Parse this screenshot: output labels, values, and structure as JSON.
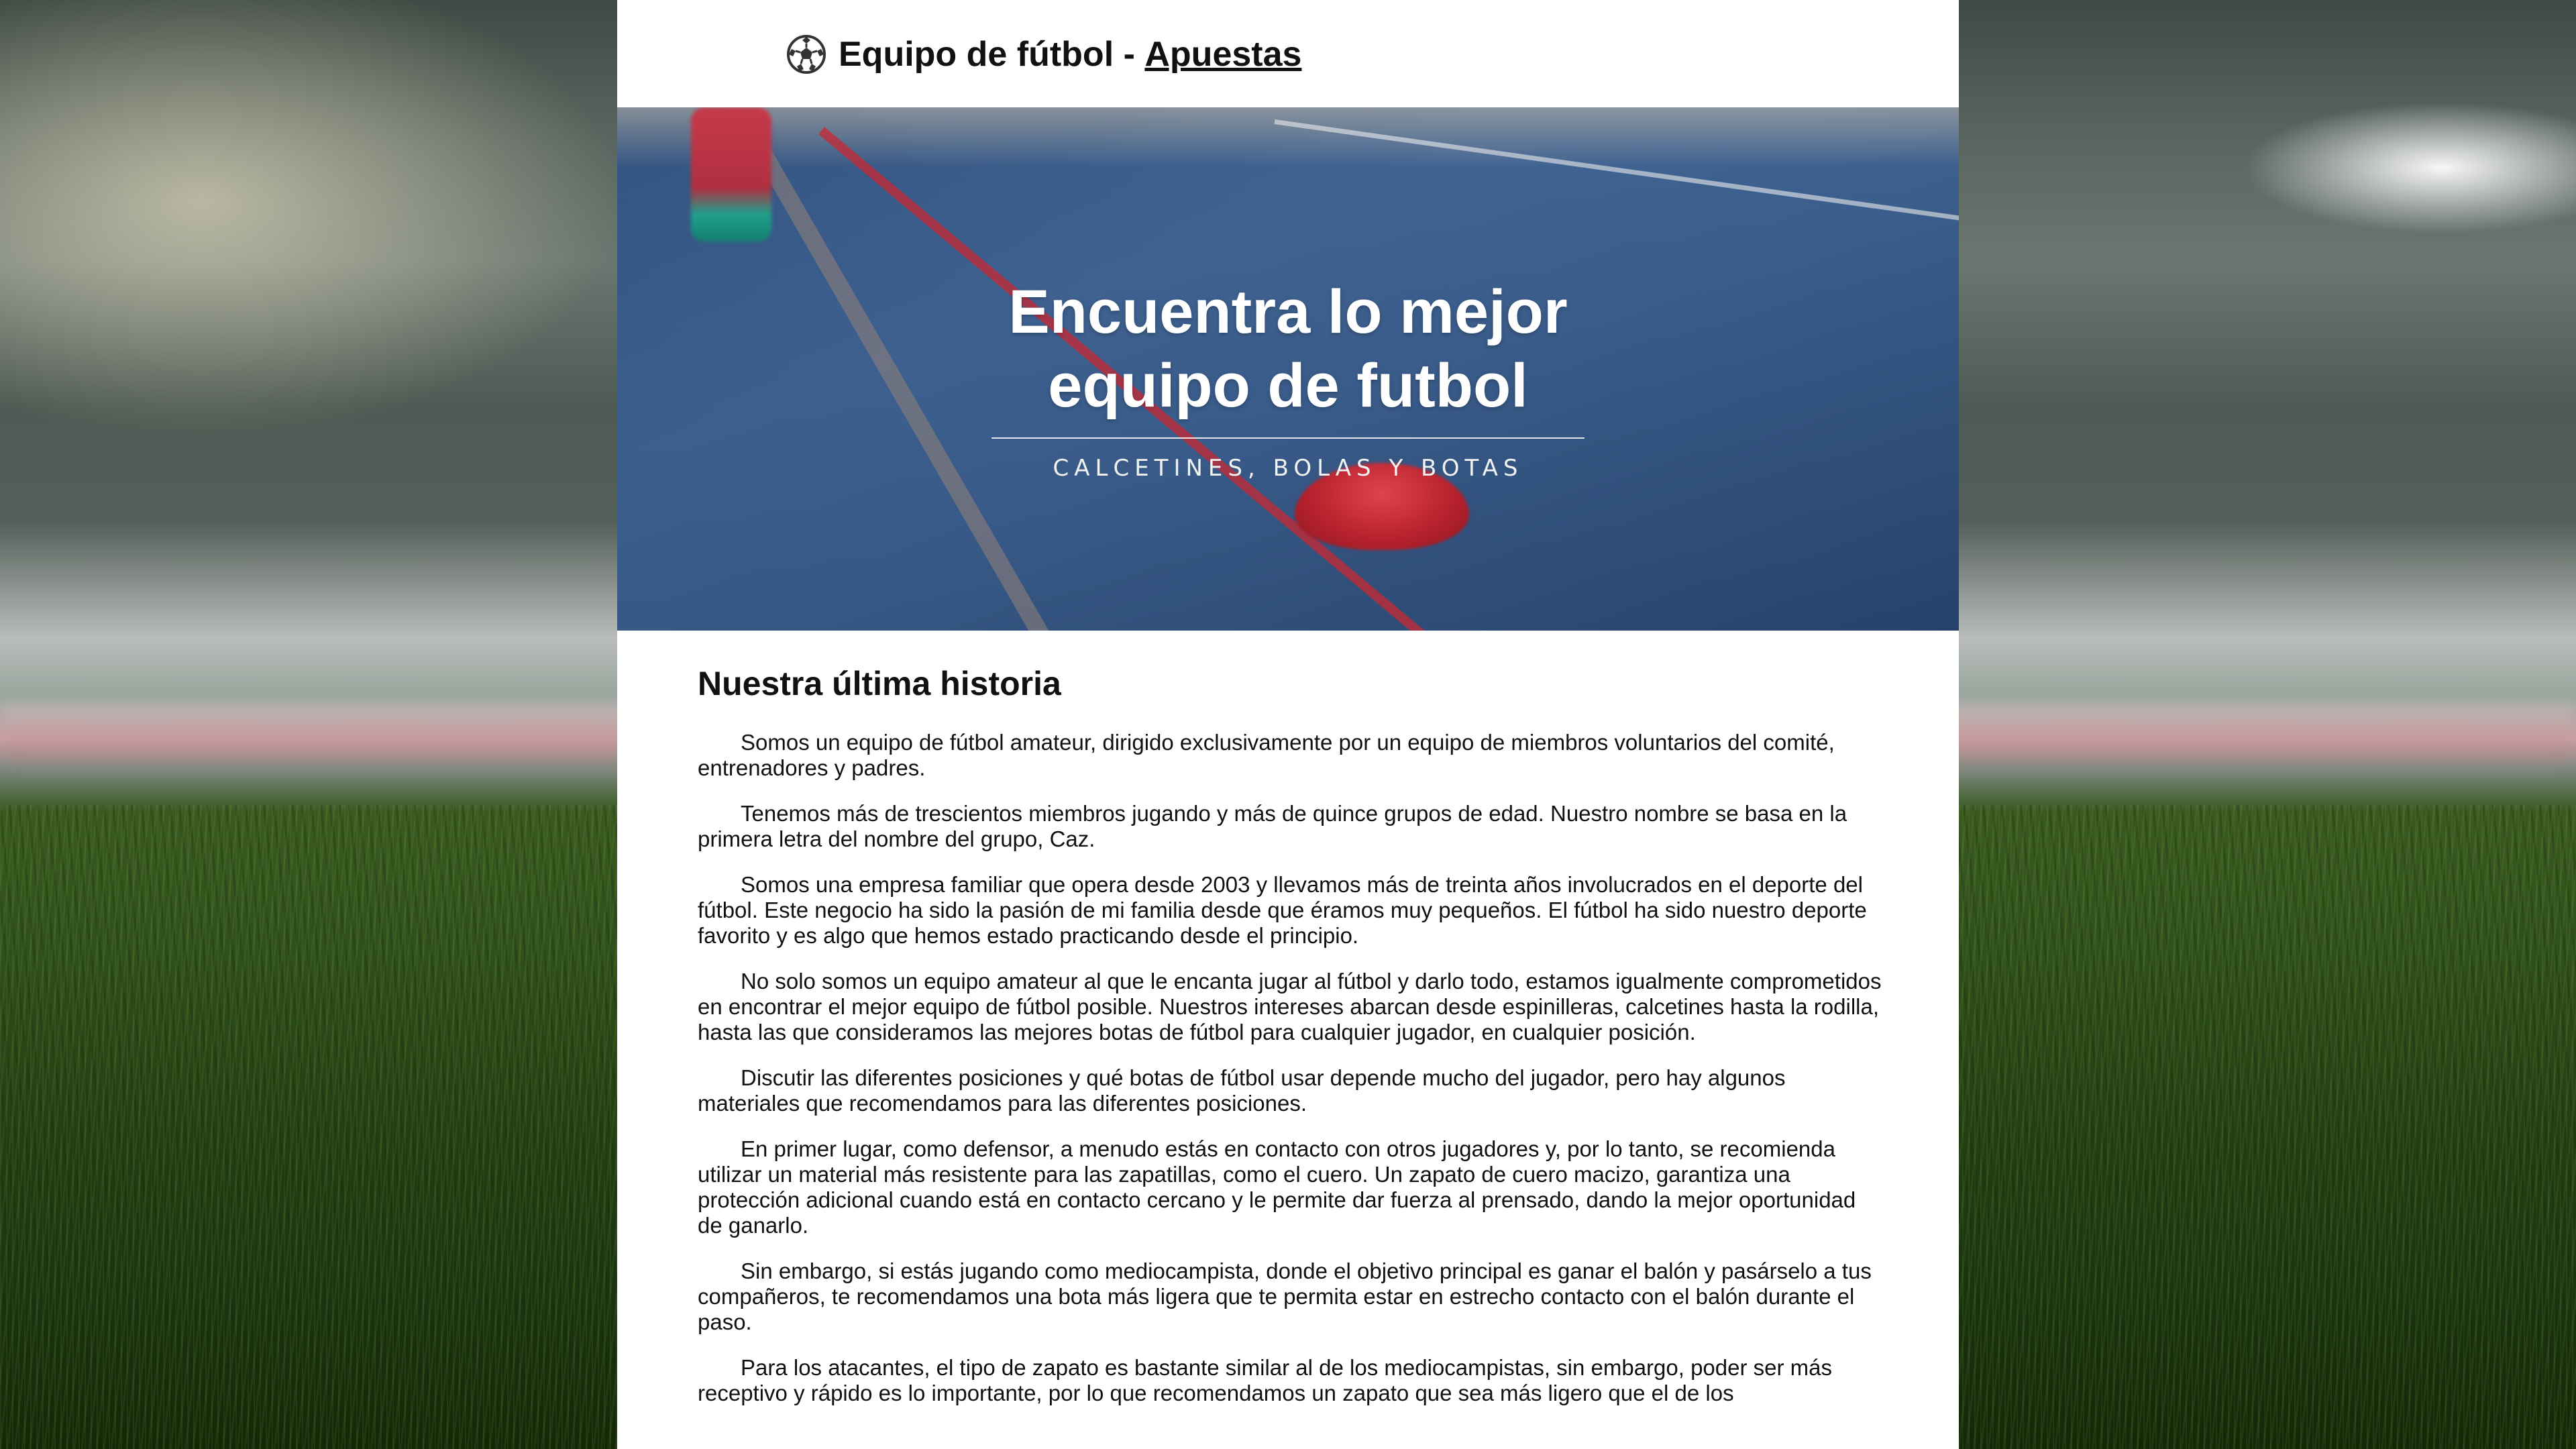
{
  "header": {
    "title_prefix": "Equipo de fútbol - ",
    "title_link": "Apuestas",
    "logo_icon": "soccer-ball-icon"
  },
  "hero": {
    "title_line1": "Encuentra lo mejor",
    "title_line2": "equipo de futbol",
    "subtitle": "CALCETINES, BOLAS Y BOTAS"
  },
  "story": {
    "heading": "Nuestra última historia",
    "paragraphs": [
      "Somos un equipo de fútbol amateur, dirigido exclusivamente por un equipo de miembros voluntarios del comité, entrenadores y padres.",
      "Tenemos más de trescientos miembros jugando y más de quince grupos de edad. Nuestro nombre se basa en la primera letra del nombre del grupo, Caz.",
      "Somos una empresa familiar que opera desde 2003 y llevamos más de treinta años involucrados en el deporte del fútbol. Este negocio ha sido la pasión de mi familia desde que éramos muy pequeños. El fútbol ha sido nuestro deporte favorito y es algo que hemos estado practicando desde el principio.",
      "No solo somos un equipo amateur al que le encanta jugar al fútbol y darlo todo, estamos igualmente comprometidos en encontrar el mejor equipo de fútbol posible. Nuestros intereses abarcan desde espinilleras, calcetines hasta la rodilla, hasta las que consideramos las mejores botas de fútbol para cualquier jugador, en cualquier posición.",
      "Discutir las diferentes posiciones y qué botas de fútbol usar depende mucho del jugador, pero hay algunos materiales que recomendamos para las diferentes posiciones.",
      "En primer lugar, como defensor, a menudo estás en contacto con otros jugadores y, por lo tanto, se recomienda utilizar un material más resistente para las zapatillas, como el cuero. Un zapato de cuero macizo, garantiza una protección adicional cuando está en contacto cercano y le permite dar fuerza al prensado, dando la mejor oportunidad de ganarlo.",
      "Sin embargo, si estás jugando como mediocampista, donde el objetivo principal es ganar el balón y pasárselo a tus compañeros, te recomendamos una bota más ligera que te permita estar en estrecho contacto con el balón durante el paso.",
      "Para los atacantes, el tipo de zapato es bastante similar al de los mediocampistas, sin embargo, poder ser más receptivo y rápido es lo importante, por lo que recomendamos un zapato que sea más ligero que el de los"
    ]
  }
}
